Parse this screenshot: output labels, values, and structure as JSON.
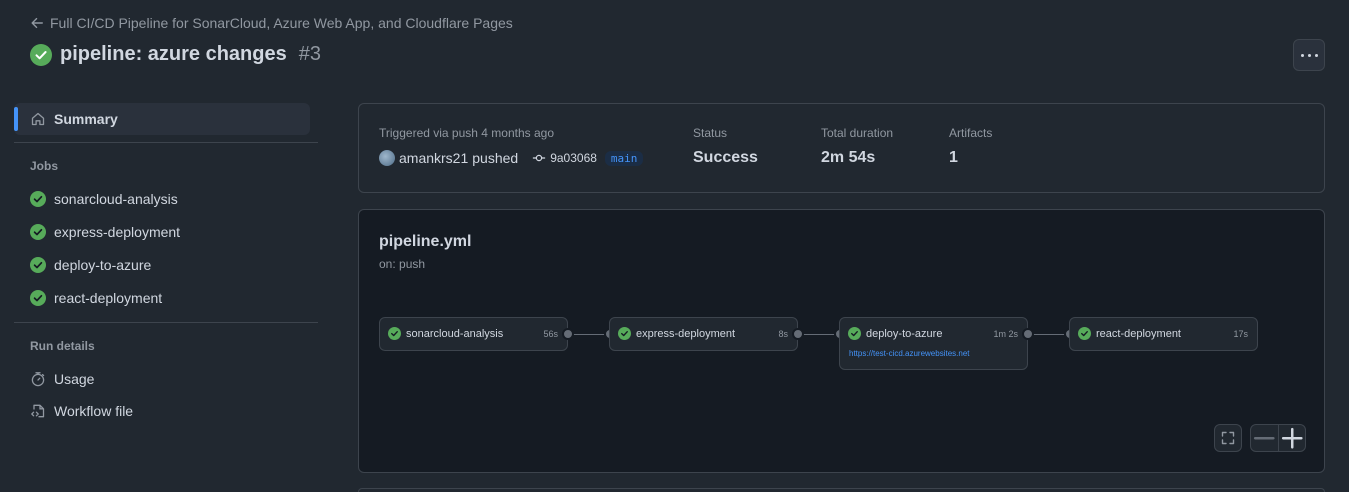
{
  "header": {
    "back_link": "Full CI/CD Pipeline for SonarCloud, Azure Web App, and Cloudflare Pages",
    "title": "pipeline: azure changes",
    "run_number": "#3"
  },
  "sidebar": {
    "summary_label": "Summary",
    "jobs_heading": "Jobs",
    "jobs": [
      {
        "label": "sonarcloud-analysis",
        "status": "success"
      },
      {
        "label": "express-deployment",
        "status": "success"
      },
      {
        "label": "deploy-to-azure",
        "status": "success"
      },
      {
        "label": "react-deployment",
        "status": "success"
      }
    ],
    "run_details_heading": "Run details",
    "run_details": [
      {
        "label": "Usage",
        "icon": "stopwatch-icon"
      },
      {
        "label": "Workflow file",
        "icon": "file-code-icon"
      }
    ]
  },
  "summary": {
    "trigger_label": "Triggered via push 4 months ago",
    "actor": "amankrs21",
    "action": "pushed",
    "commit": "9a03068",
    "branch": "main",
    "status_label": "Status",
    "status_value": "Success",
    "duration_label": "Total duration",
    "duration_value": "2m 54s",
    "artifacts_label": "Artifacts",
    "artifacts_value": "1"
  },
  "workflow": {
    "file": "pipeline.yml",
    "trigger": "on: push",
    "jobs": [
      {
        "name": "sonarcloud-analysis",
        "duration": "56s"
      },
      {
        "name": "express-deployment",
        "duration": "8s"
      },
      {
        "name": "deploy-to-azure",
        "duration": "1m 2s",
        "url": "https://test-cicd.azurewebsites.net"
      },
      {
        "name": "react-deployment",
        "duration": "17s"
      }
    ]
  },
  "colors": {
    "success": "#57ab5a",
    "accent": "#4493f8",
    "background": "#212830",
    "graph_background": "#151b23",
    "border": "#3d444d"
  }
}
